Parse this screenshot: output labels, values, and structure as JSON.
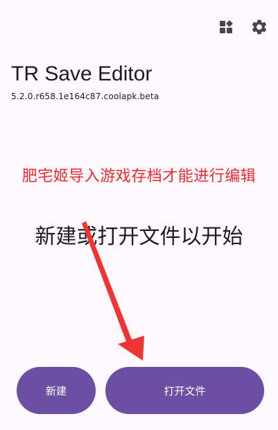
{
  "toolbar": {
    "icons": [
      "widgets-icon",
      "settings-gear-icon"
    ]
  },
  "header": {
    "title": "TR Save Editor",
    "version": "5.2.0.r658.1e164c87.coolapk.beta"
  },
  "annotation": {
    "text": "肥宅姬导入游戏存档才能进行编辑",
    "color": "#f02a2a"
  },
  "main": {
    "hint": "新建或打开文件以开始"
  },
  "actions": {
    "new_label": "新建",
    "open_label": "打开文件"
  },
  "colors": {
    "background": "#fdf7fe",
    "button": "#6a4fa3",
    "annotation": "#f02a2a"
  }
}
